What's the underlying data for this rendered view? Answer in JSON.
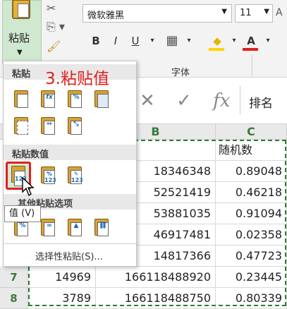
{
  "ribbon": {
    "paste_label": "粘贴",
    "font_name": "微软雅黑",
    "font_size": "11",
    "bold": "B",
    "italic": "I",
    "underline": "U",
    "font_group_label": "字体",
    "increase_font": "A",
    "decrease_font": "A"
  },
  "formula_bar": {
    "cancel": "✕",
    "confirm": "✓",
    "fx": "fx",
    "content": "排名"
  },
  "grid": {
    "columns": [
      "B",
      "C"
    ],
    "header_c_title": "随机数",
    "rows": [
      {
        "row": "",
        "a": "",
        "b": "18346348",
        "c": "0.89048"
      },
      {
        "row": "",
        "a": "",
        "b": "52521419",
        "c": "0.46218"
      },
      {
        "row": "",
        "a": "",
        "b": "53881035",
        "c": "0.91094"
      },
      {
        "row": "",
        "a": "",
        "b": "46917481",
        "c": "0.02358"
      },
      {
        "row": "",
        "a": "",
        "b": "14817366",
        "c": "0.47723"
      },
      {
        "row": "7",
        "a": "14969",
        "b": "166118488920",
        "c": "0.23445"
      },
      {
        "row": "8",
        "a": "3789",
        "b": "166118488750",
        "c": "0.80339"
      }
    ]
  },
  "paste_menu": {
    "step_annotation": "3.粘贴值",
    "section_paste": "粘贴",
    "section_paste_values": "粘贴数值",
    "section_other": "其他粘贴选项",
    "tooltip": "值 (V)",
    "paste_special": "选择性粘贴(S)...",
    "values_badge": "123"
  },
  "colors": {
    "accent_green": "#2e7d32",
    "annotation_red": "#e02020",
    "paste_highlight": "#cfe8cf"
  }
}
